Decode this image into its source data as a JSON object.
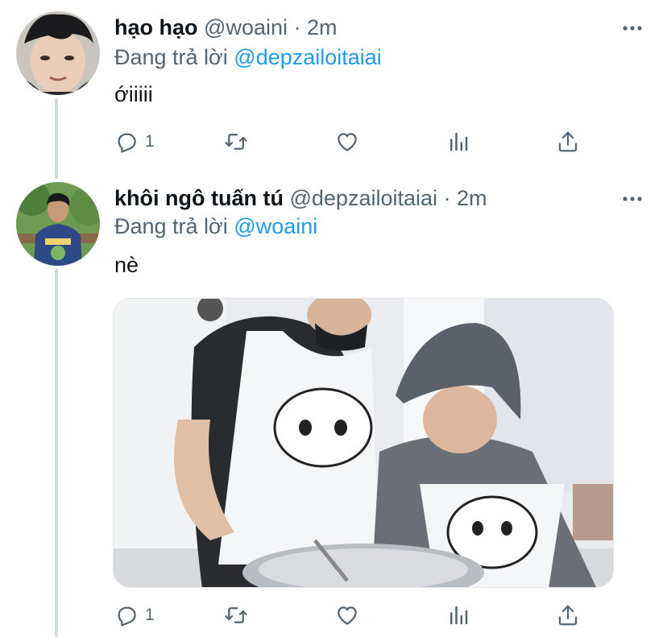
{
  "tweets": [
    {
      "display_name": "hạo hạo",
      "handle": "@woaini",
      "separator": "·",
      "time": "2m",
      "replying_prefix": "Đang trả lời",
      "replying_to": "@depzailoitaiai",
      "text": "ớiiiii",
      "reply_count": "1"
    },
    {
      "display_name": "khôi ngô tuấn tú",
      "handle": "@depzailoitaiai",
      "separator": "·",
      "time": "2m",
      "replying_prefix": "Đang trả lời",
      "replying_to": "@woaini",
      "text": "nè",
      "reply_count": "1"
    }
  ],
  "icons": {
    "more": "more-icon",
    "reply": "reply-icon",
    "retweet": "retweet-icon",
    "like": "heart-icon",
    "views": "views-icon",
    "share": "share-icon"
  },
  "colors": {
    "link": "#1d9bf0",
    "secondary": "#536471",
    "thread_line": "#cfd9de"
  }
}
